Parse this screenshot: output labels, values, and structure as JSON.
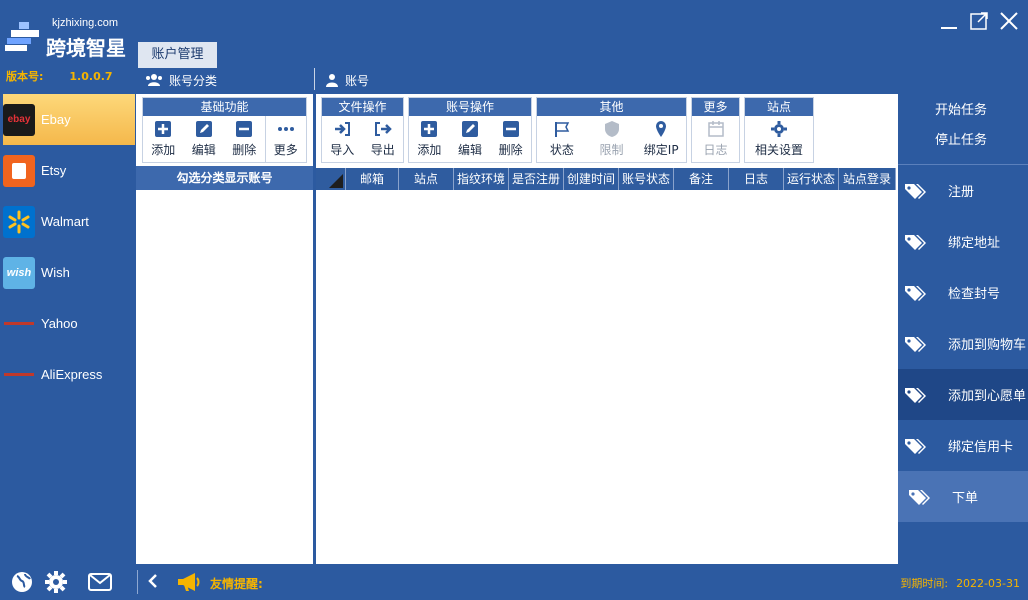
{
  "app": {
    "url": "kjzhixing.com",
    "name": "跨境智星",
    "version_label": "版本号:",
    "version": "1.0.0.7"
  },
  "tab": {
    "label": "账户管理"
  },
  "headers": {
    "category": "账号分类",
    "account": "账号"
  },
  "platforms": [
    {
      "name": "Ebay",
      "icon": "ebay-logo",
      "active": true
    },
    {
      "name": "Etsy",
      "icon": "etsy-logo"
    },
    {
      "name": "Walmart",
      "icon": "walmart-logo"
    },
    {
      "name": "Wish",
      "icon": "wish-logo"
    },
    {
      "name": "Yahoo",
      "icon": "yahoo-logo"
    },
    {
      "name": "AliExpress",
      "icon": "aliexpress-logo"
    }
  ],
  "basic": {
    "title": "基础功能",
    "buttons": [
      "添加",
      "编辑",
      "删除",
      "更多"
    ]
  },
  "category_list_header": "勾选分类显示账号",
  "toolbar": {
    "file": {
      "title": "文件操作",
      "buttons": [
        "导入",
        "导出"
      ]
    },
    "account": {
      "title": "账号操作",
      "buttons": [
        "添加",
        "编辑",
        "删除"
      ]
    },
    "other": {
      "title": "其他",
      "buttons": [
        "状态",
        "限制",
        "绑定IP"
      ]
    },
    "more": {
      "title": "更多",
      "buttons": [
        "日志"
      ]
    },
    "site": {
      "title": "站点",
      "buttons": [
        "相关设置"
      ]
    }
  },
  "columns": [
    "邮箱",
    "站点",
    "指纹环境",
    "是否注册",
    "创建时间",
    "账号状态",
    "备注",
    "日志",
    "运行状态",
    "站点登录"
  ],
  "tasks": {
    "start": "开始任务",
    "stop": "停止任务"
  },
  "actions": [
    "注册",
    "绑定地址",
    "检查封号",
    "添加到购物车",
    "添加到心愿单",
    "绑定信用卡",
    "下单"
  ],
  "footer": {
    "notice": "友情提醒:",
    "expire_label": "到期时间:",
    "expire_date": "2022-03-31"
  },
  "colors": {
    "accent": "#f5b400",
    "bg": "#2c5aa0",
    "header": "#3d69ad"
  }
}
